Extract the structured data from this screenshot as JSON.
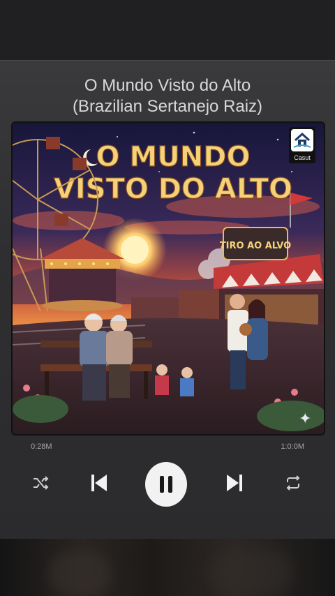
{
  "track": {
    "title_line1": "O Mundo Visto do Alto",
    "title_line2": "(Brazilian Sertanejo Raiz)"
  },
  "album_art": {
    "headline_line1": "O MUNDO",
    "headline_line2": "VISTO DO ALTO",
    "stall_sign": "TIRO AO ALVO",
    "badge_label": "Casut"
  },
  "progress": {
    "elapsed": "0:28M",
    "total": "1:0:0M"
  },
  "controls": {
    "shuffle": "shuffle-icon",
    "previous": "skip-previous-icon",
    "play_state": "pause-icon",
    "next": "skip-next-icon",
    "repeat": "repeat-icon"
  },
  "colors": {
    "accent": "#f2f2f2",
    "text": "#d8d8da",
    "muted": "#a8a8ab"
  }
}
